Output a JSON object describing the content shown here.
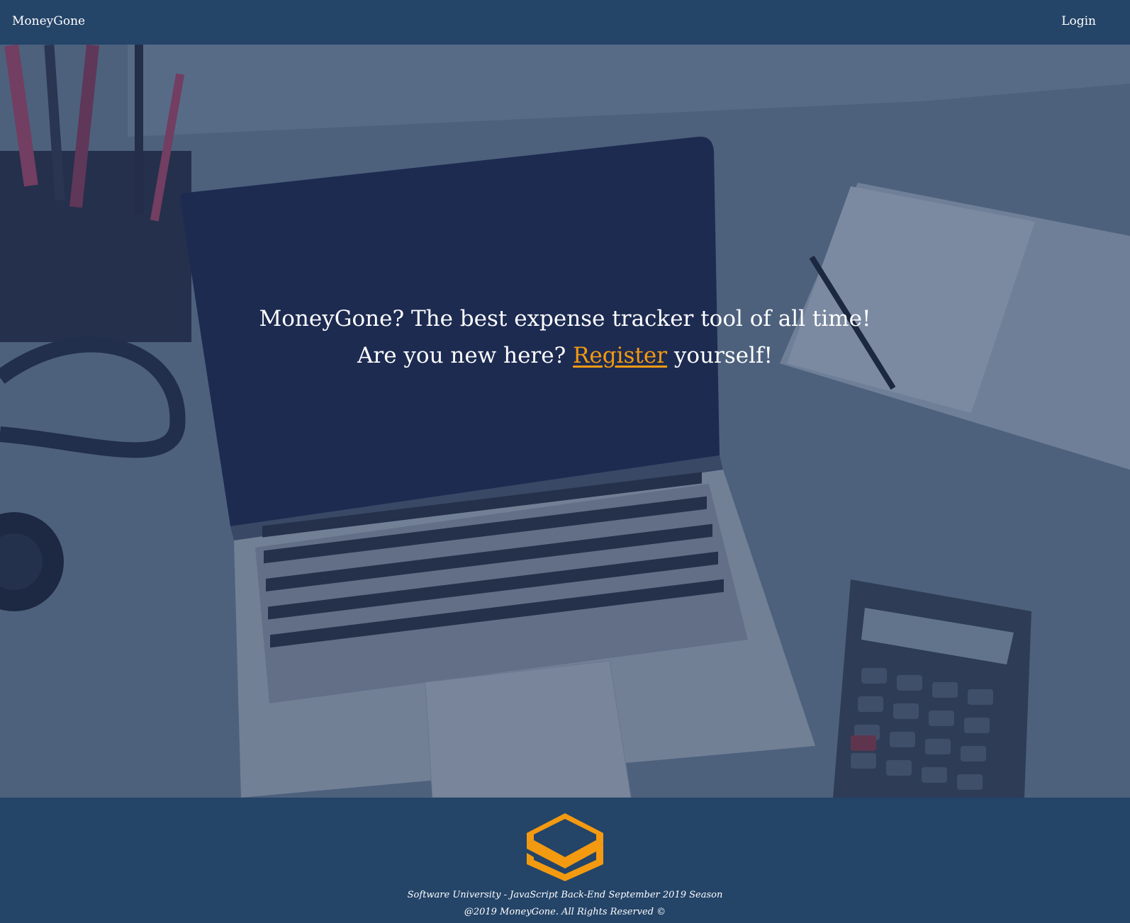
{
  "navbar": {
    "brand": "MoneyGone",
    "login_label": "Login"
  },
  "hero": {
    "headline": "MoneyGone? The best expense tracker tool of all time!",
    "subline_before": "Are you new here? ",
    "register_label": "Register",
    "subline_after": " yourself!",
    "background_image": "desk-with-laptop-calculator-notebook"
  },
  "footer": {
    "logo_icon": "softuni-logo-icon",
    "line1": "Software University - JavaScript Back-End September 2019 Season",
    "line2": "@2019 MoneyGone. All Rights Reserved ©"
  },
  "colors": {
    "navbar_bg": "#244468",
    "accent": "#f39a11",
    "text": "#ffffff"
  }
}
